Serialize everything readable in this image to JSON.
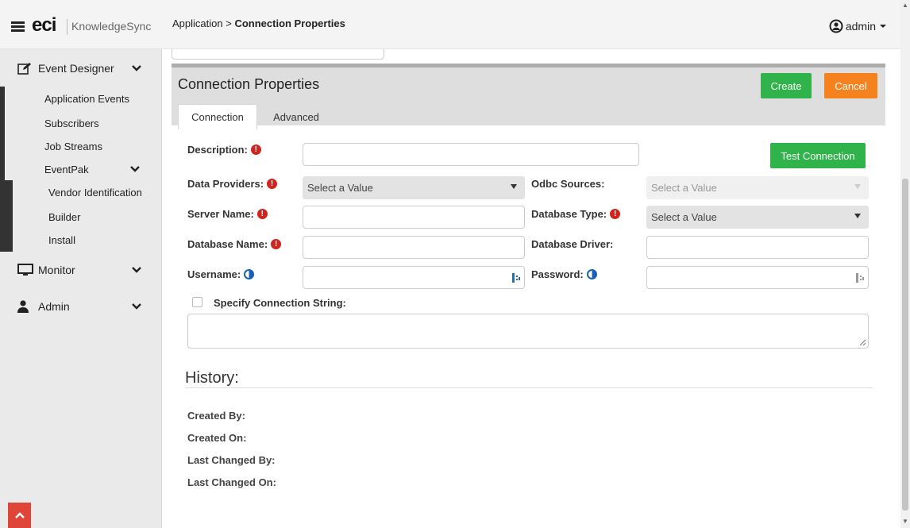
{
  "header": {
    "logo_text": "eci",
    "product_name": "KnowledgeSync",
    "breadcrumb_parent": "Application",
    "breadcrumb_separator": ">",
    "breadcrumb_current": "Connection Properties",
    "user_name": "admin"
  },
  "sidebar": {
    "event_designer": "Event Designer",
    "application_events": "Application Events",
    "subscribers": "Subscribers",
    "job_streams": "Job Streams",
    "eventpak": "EventPak",
    "vendor_identification": "Vendor Identification",
    "builder": "Builder",
    "install": "Install",
    "monitor": "Monitor",
    "admin": "Admin"
  },
  "panel": {
    "title": "Connection Properties",
    "create_label": "Create",
    "cancel_label": "Cancel",
    "tabs": [
      "Connection",
      "Advanced"
    ],
    "active_tab": "Connection"
  },
  "form": {
    "description_label": "Description:",
    "test_connection_label": "Test Connection",
    "data_providers_label": "Data Providers:",
    "data_providers_value": "Select a Value",
    "odbc_sources_label": "Odbc Sources:",
    "odbc_sources_value": "Select a Value",
    "server_name_label": "Server Name:",
    "database_type_label": "Database Type:",
    "database_type_value": "Select a Value",
    "database_name_label": "Database Name:",
    "database_driver_label": "Database Driver:",
    "username_label": "Username:",
    "password_label": "Password:",
    "specify_conn_label": "Specify Connection String:"
  },
  "history": {
    "title": "History:",
    "created_by": "Created By:",
    "created_on": "Created On:",
    "last_changed_by": "Last Changed By:",
    "last_changed_on": "Last Changed On:"
  },
  "colors": {
    "accent_green": "#2fb34a",
    "accent_orange": "#f5821f",
    "required_red": "#d0241e",
    "scroll_top_red": "#e0453a"
  }
}
